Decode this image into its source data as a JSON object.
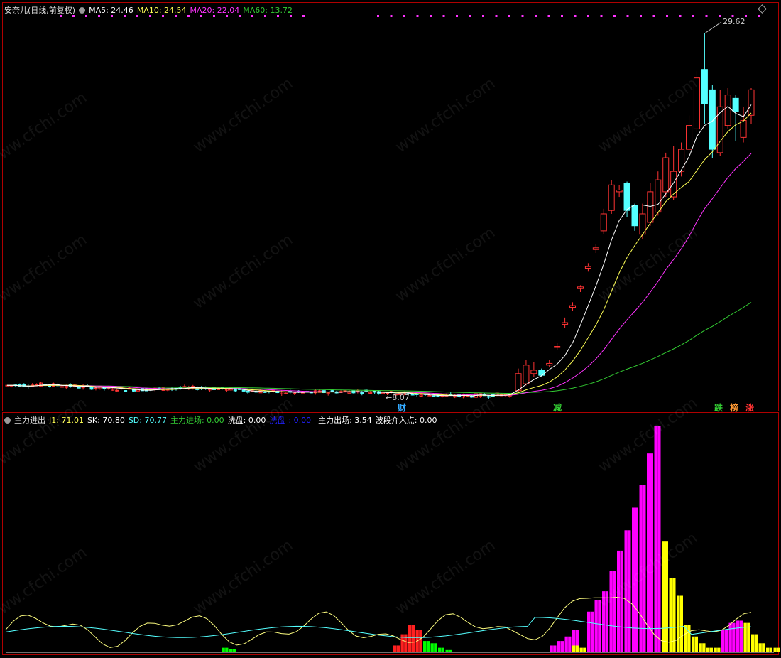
{
  "colors": {
    "up": "#ff3333",
    "down": "#54ffff",
    "ma5": "#ffffff",
    "ma10": "#ffff55",
    "ma20": "#ff33ff",
    "ma60": "#33cc33",
    "frame": "#b00000",
    "magenta_bar": "#ff00ff",
    "yellow_bar": "#ffff00",
    "red_bar": "#ff2020",
    "green_bar": "#00ff00",
    "sk_line": "#ffff80",
    "sd_line": "#54ffff"
  },
  "main_panel": {
    "title": "安奈儿(日线,前复权)",
    "ma5_label": "MA5: 24.46",
    "ma10_label": "MA10: 24.54",
    "ma20_label": "MA20: 22.04",
    "ma60_label": "MA60: 13.72",
    "high_label": "29.62",
    "low_label": "←8.07",
    "signal_markers": [
      {
        "text": "财",
        "color": "#33aaff"
      },
      {
        "text": "减",
        "color": "#33cc33"
      },
      {
        "text": "跌",
        "color": "#33cc33"
      },
      {
        "text": "榜",
        "color": "#ff9933"
      },
      {
        "text": "涨",
        "color": "#ff3333"
      }
    ]
  },
  "indicator_panel": {
    "name": "主力进出",
    "j1_label": "J1: 71.01",
    "sk_label": "SK: 70.80",
    "sd_label": "SD: 70.77",
    "enter_label": "主力进场: 0.00",
    "wash_label": "洗盘: 0.00",
    "hidden_label": "洗盘",
    "hidden_value": "0.00",
    "exit_label": "主力出场: 3.54",
    "wave_label": "波段介入点: 0.00"
  },
  "watermark_text": "www.cfchi.com",
  "chart_data": [
    {
      "type": "candlestick",
      "title": "安奈儿(日线,前复权)",
      "ylim": [
        7.5,
        31
      ],
      "flat_period": {
        "start_price": 8.9,
        "end_price": 8.3,
        "min_price": 8.07
      },
      "rally": {
        "open": [
          8.6,
          9.0,
          9.6,
          9.8,
          10.1,
          11.2,
          12.5,
          13.5,
          14.6,
          15.8,
          16.9,
          18.0,
          19.2,
          20.3,
          20.8,
          19.5,
          17.8,
          18.5,
          19.1,
          20.3,
          20.0,
          21.5,
          22.8,
          24.0,
          27.5,
          26.3,
          22.6,
          24.2,
          25.8,
          23.5,
          24.8
        ],
        "close": [
          9.6,
          10.1,
          9.8,
          9.5,
          10.2,
          11.2,
          12.6,
          13.6,
          14.7,
          15.9,
          17.0,
          19.0,
          20.7,
          20.4,
          19.2,
          18.3,
          19.0,
          20.3,
          21.0,
          22.3,
          21.5,
          22.8,
          24.2,
          27.0,
          25.5,
          22.8,
          25.3,
          26.0,
          25.0,
          24.5,
          26.3
        ],
        "high": [
          9.9,
          10.4,
          10.3,
          9.9,
          10.4,
          11.4,
          12.9,
          13.8,
          14.8,
          16.1,
          17.2,
          19.3,
          21.0,
          20.7,
          20.9,
          19.6,
          19.6,
          20.8,
          21.5,
          22.6,
          23.0,
          23.2,
          24.8,
          27.4,
          29.62,
          26.6,
          26.3,
          26.4,
          26.0,
          25.3,
          26.4
        ],
        "low": [
          8.5,
          8.9,
          9.4,
          9.4,
          10.0,
          11.0,
          12.3,
          13.3,
          14.4,
          15.6,
          16.7,
          17.8,
          19.0,
          20.0,
          18.8,
          18.0,
          17.5,
          18.3,
          18.9,
          20.0,
          19.8,
          21.2,
          22.6,
          23.8,
          24.3,
          22.3,
          22.4,
          24.0,
          23.3,
          23.2,
          24.3
        ]
      },
      "series": [
        {
          "name": "MA5",
          "last": 24.46
        },
        {
          "name": "MA10",
          "last": 24.54
        },
        {
          "name": "MA20",
          "last": 22.04
        },
        {
          "name": "MA60",
          "last": 13.72
        }
      ],
      "high": 29.62,
      "low": 8.07
    },
    {
      "type": "bar",
      "title": "主力进出",
      "ylim": [
        0,
        100
      ],
      "red_bars": [
        {
          "i": 52,
          "v": 3
        },
        {
          "i": 53,
          "v": 8
        },
        {
          "i": 54,
          "v": 12
        },
        {
          "i": 55,
          "v": 10
        }
      ],
      "green_bars": [
        {
          "i": 29,
          "v": 2
        },
        {
          "i": 30,
          "v": 1.5
        },
        {
          "i": 56,
          "v": 5
        },
        {
          "i": 57,
          "v": 4
        },
        {
          "i": 58,
          "v": 2
        },
        {
          "i": 59,
          "v": 1
        }
      ],
      "magenta_bars": [
        {
          "i": 73,
          "v": 3
        },
        {
          "i": 74,
          "v": 5
        },
        {
          "i": 75,
          "v": 7
        },
        {
          "i": 76,
          "v": 10
        },
        {
          "i": 78,
          "v": 18
        },
        {
          "i": 79,
          "v": 23
        },
        {
          "i": 80,
          "v": 27
        },
        {
          "i": 81,
          "v": 36
        },
        {
          "i": 82,
          "v": 45
        },
        {
          "i": 83,
          "v": 54
        },
        {
          "i": 84,
          "v": 64
        },
        {
          "i": 85,
          "v": 74
        },
        {
          "i": 86,
          "v": 88
        },
        {
          "i": 87,
          "v": 100
        },
        {
          "i": 96,
          "v": 10
        },
        {
          "i": 97,
          "v": 13
        },
        {
          "i": 98,
          "v": 14
        }
      ],
      "yellow_bars": [
        {
          "i": 76,
          "v": 3
        },
        {
          "i": 77,
          "v": 2
        },
        {
          "i": 88,
          "v": 49
        },
        {
          "i": 89,
          "v": 33
        },
        {
          "i": 90,
          "v": 25
        },
        {
          "i": 91,
          "v": 12
        },
        {
          "i": 92,
          "v": 7
        },
        {
          "i": 93,
          "v": 4
        },
        {
          "i": 94,
          "v": 2
        },
        {
          "i": 95,
          "v": 2
        },
        {
          "i": 99,
          "v": 13
        },
        {
          "i": 100,
          "v": 8
        },
        {
          "i": 101,
          "v": 4
        },
        {
          "i": 102,
          "v": 2
        },
        {
          "i": 103,
          "v": 2
        },
        {
          "i": 104,
          "v": 1
        }
      ],
      "series": [
        {
          "name": "SK",
          "last": 70.8
        },
        {
          "name": "SD",
          "last": 70.77
        }
      ]
    }
  ]
}
